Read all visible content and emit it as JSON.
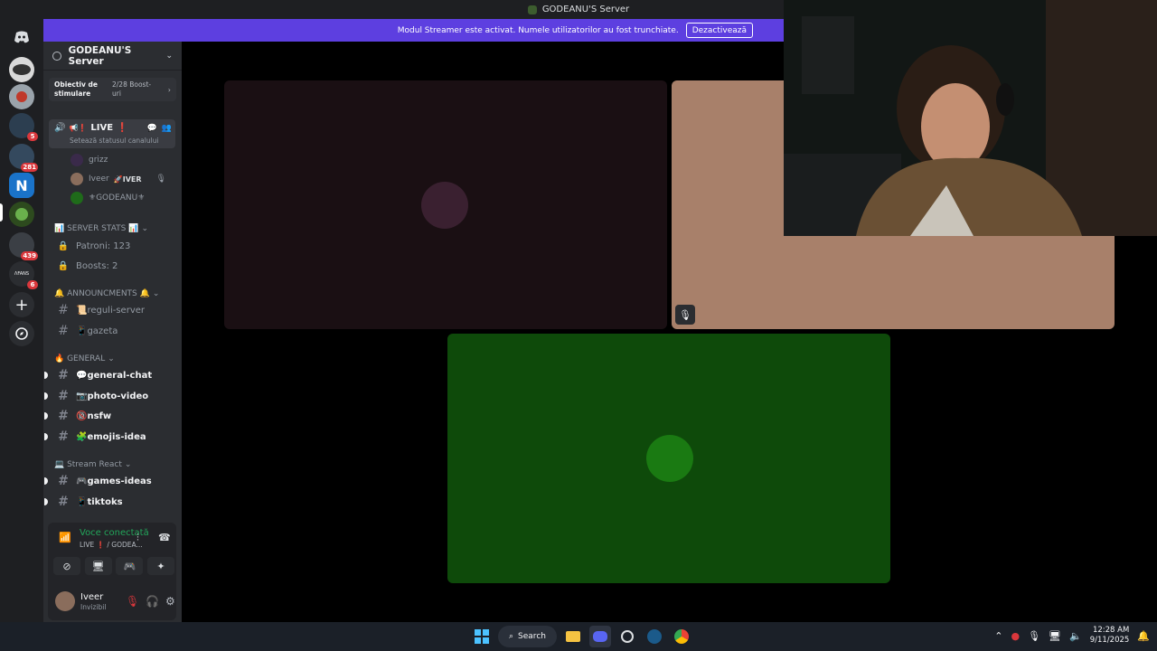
{
  "window": {
    "title": "GODEANU'S Server"
  },
  "banner": {
    "message": "Modul Streamer este activat. Numele utilizatorilor au fost trunchiate.",
    "button": "Dezactivează"
  },
  "rail": {
    "badges": [
      "5",
      "281",
      "439",
      "6"
    ]
  },
  "server": {
    "name": "GODEANU'S Server",
    "boost_title": "Obiectiv de stimulare",
    "boost_progress": "2/28 Boost-uri"
  },
  "live_channel": {
    "name": "LIVE",
    "status_hint": "Setează statusul canalului",
    "users": [
      {
        "name": "grizz"
      },
      {
        "name": "Iveer",
        "tag": "🚀IVER"
      },
      {
        "name": "⚜GODEANU⚜"
      }
    ]
  },
  "categories": {
    "server_stats": "📊 SERVER STATS 📊",
    "announcments": "🔔 ANNOUNCMENTS 🔔",
    "general": "🔥 GENERAL",
    "stream_react": "💻 Stream React"
  },
  "channels": {
    "patroni": "Patroni: 123",
    "boosts": "Boosts: 2",
    "reguli": "📜reguli-server",
    "gazeta": "📱gazeta",
    "general_chat": "💬general-chat",
    "photo_video": "📷photo-video",
    "nsfw": "🔞nsfw",
    "emojis": "🧩emojis-idea",
    "games": "🎮games-ideas",
    "tiktoks": "📱tiktoks"
  },
  "voice": {
    "status": "Voce conectată",
    "sub": "LIVE ❗ / GODEA..."
  },
  "user": {
    "name": "Iveer",
    "status": "Invizibil"
  },
  "taskbar": {
    "search": "Search",
    "time": "12:28 AM",
    "date": "9/11/2025"
  },
  "colors": {
    "brand": "#5865f2",
    "banner": "#5d3fe0",
    "connected_green": "#23a55a",
    "tile1": "#1a0f13",
    "tile2": "#a8806a",
    "tile3": "#0e4a0a"
  }
}
